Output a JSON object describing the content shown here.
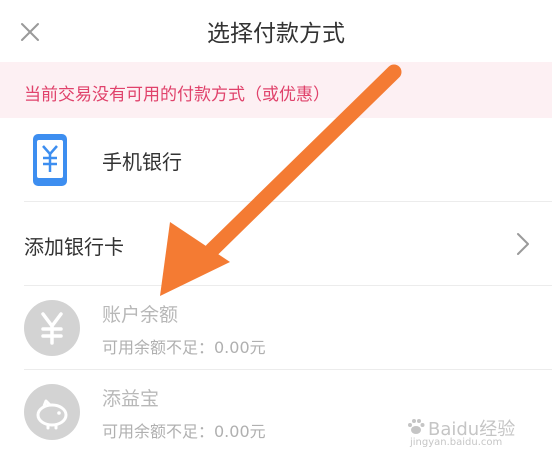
{
  "header": {
    "title": "选择付款方式"
  },
  "notice": {
    "text": "当前交易没有可用的付款方式（或优惠）"
  },
  "methods": {
    "mobile_bank": {
      "label": "手机银行",
      "icon": "mobile-bank-icon"
    },
    "add_card": {
      "label": "添加银行卡",
      "icon": "chevron-right-icon"
    },
    "balance": {
      "label": "账户余额",
      "sub": "可用余额不足：0.00元",
      "icon": "yuan-icon"
    },
    "tianyibao": {
      "label": "添益宝",
      "sub": "可用余额不足：0.00元",
      "icon": "piggy-bank-icon"
    }
  },
  "colors": {
    "notice_text": "#e0426b",
    "notice_bg": "#fdf0f3",
    "accent_blue": "#3d8ef0",
    "arrow": "#f47b33",
    "disabled_icon": "#d3d3d3"
  },
  "watermark": {
    "brand": "Baidu经验",
    "sub": "jingyan.baidu.com"
  }
}
